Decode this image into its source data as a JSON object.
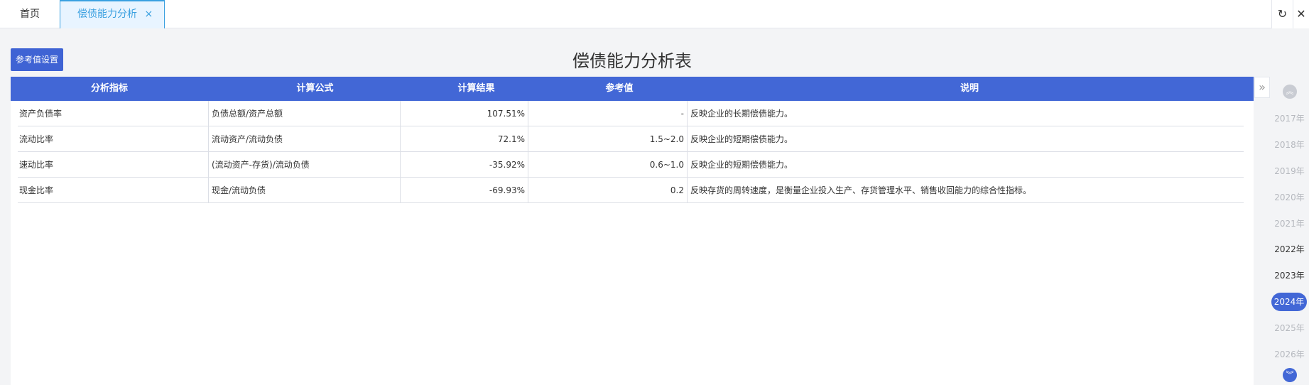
{
  "tabs": {
    "home": "首页",
    "active": "偿债能力分析",
    "active_close": "×"
  },
  "toolbar": {
    "refresh_icon": "↻",
    "close_icon": "✕"
  },
  "settings_button": "参考值设置",
  "page_title": "偿债能力分析表",
  "table": {
    "headers": [
      "分析指标",
      "计算公式",
      "计算结果",
      "参考值",
      "说明"
    ],
    "rows": [
      [
        "资产负债率",
        "负债总额/资产总额",
        "107.51%",
        "-",
        "反映企业的长期偿债能力。"
      ],
      [
        "流动比率",
        "流动资产/流动负债",
        "72.1%",
        "1.5~2.0",
        "反映企业的短期偿债能力。"
      ],
      [
        "速动比率",
        "(流动资产-存货)/流动负债",
        "-35.92%",
        "0.6~1.0",
        "反映企业的短期偿债能力。"
      ],
      [
        "现金比率",
        "现金/流动负债",
        "-69.93%",
        "0.2",
        "反映存货的周转速度，是衡量企业投入生产、存货管理水平、销售收回能力的综合性指标。"
      ]
    ]
  },
  "timeline": {
    "collapse_icon": "»",
    "up_icon": "︽",
    "down_icon": "︾",
    "years": [
      "2017年",
      "2018年",
      "2019年",
      "2020年",
      "2021年",
      "2022年",
      "2023年",
      "2024年",
      "2025年",
      "2026年"
    ],
    "selected": "2024年"
  },
  "colors": {
    "primary": "#4267d6",
    "tab_active_text": "#3aa0e0"
  }
}
